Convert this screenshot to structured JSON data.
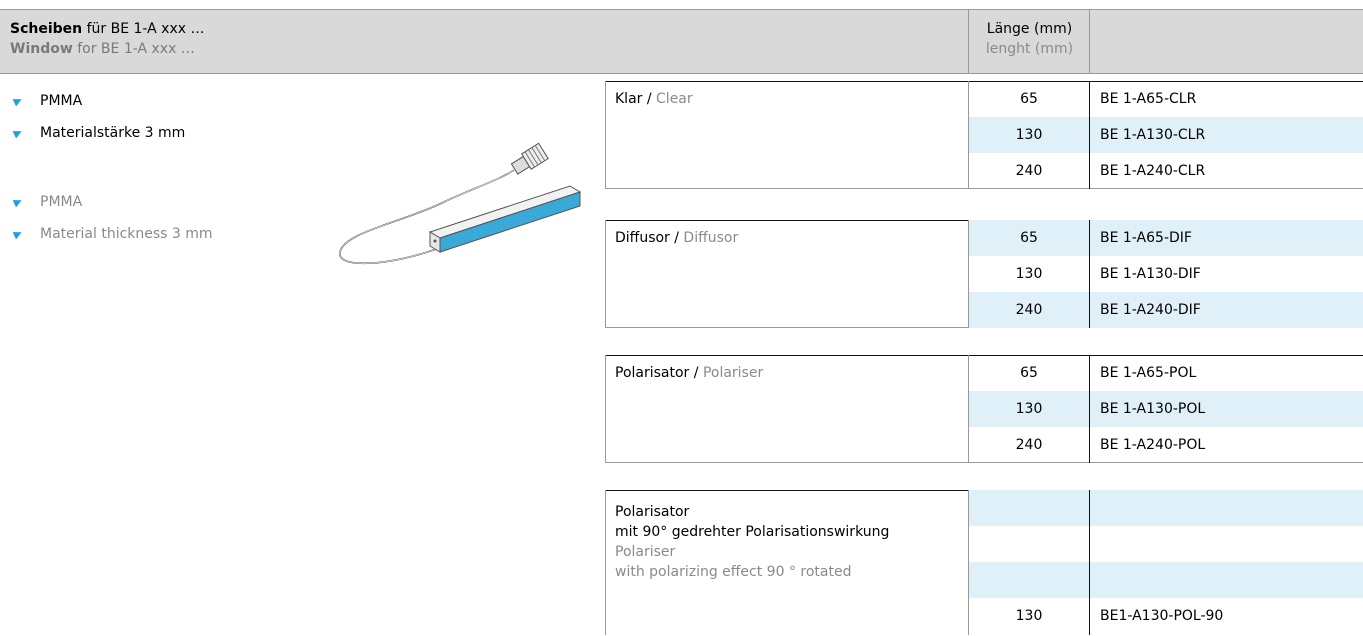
{
  "header": {
    "title_de_bold": "Scheiben",
    "title_de_rest": " für BE 1-A xxx …",
    "title_en_bold": "Window",
    "title_en_rest": " for BE 1-A xxx …",
    "len_de": "Länge (mm)",
    "len_en": "lenght (mm)"
  },
  "features_de": [
    "PMMA",
    "Materialstärke 3 mm"
  ],
  "features_en": [
    "PMMA",
    "Material thickness 3 mm"
  ],
  "tables": [
    {
      "name_de": "Klar / ",
      "name_en": "Clear",
      "rows": [
        {
          "length": "65",
          "code": "BE 1-A65-CLR"
        },
        {
          "length": "130",
          "code": "BE 1-A130-CLR"
        },
        {
          "length": "240",
          "code": "BE 1-A240-CLR"
        }
      ]
    },
    {
      "name_de": "Diffusor / ",
      "name_en": "Diffusor",
      "rows": [
        {
          "length": "65",
          "code": "BE 1-A65-DIF"
        },
        {
          "length": "130",
          "code": "BE 1-A130-DIF"
        },
        {
          "length": "240",
          "code": "BE 1-A240-DIF"
        }
      ]
    },
    {
      "name_de": "Polarisator / ",
      "name_en": "Polariser",
      "rows": [
        {
          "length": "65",
          "code": "BE 1-A65-POL"
        },
        {
          "length": "130",
          "code": "BE 1-A130-POL"
        },
        {
          "length": "240",
          "code": "BE 1-A240-POL"
        }
      ]
    },
    {
      "lines_de": [
        "Polarisator",
        "mit 90° gedrehter Polarisationswirkung"
      ],
      "lines_en": [
        "Polariser",
        "with polarizing effect 90 ° rotated"
      ],
      "rows": [
        {
          "length": "",
          "code": ""
        },
        {
          "length": "",
          "code": ""
        },
        {
          "length": "",
          "code": ""
        },
        {
          "length": "130",
          "code": "BE1-A130-POL-90"
        }
      ]
    }
  ],
  "colors": {
    "accent": "#1f9ee0",
    "shade": "#dff0f8",
    "header_bg": "#d9d9d9",
    "grey_text": "#8a8a8a"
  }
}
